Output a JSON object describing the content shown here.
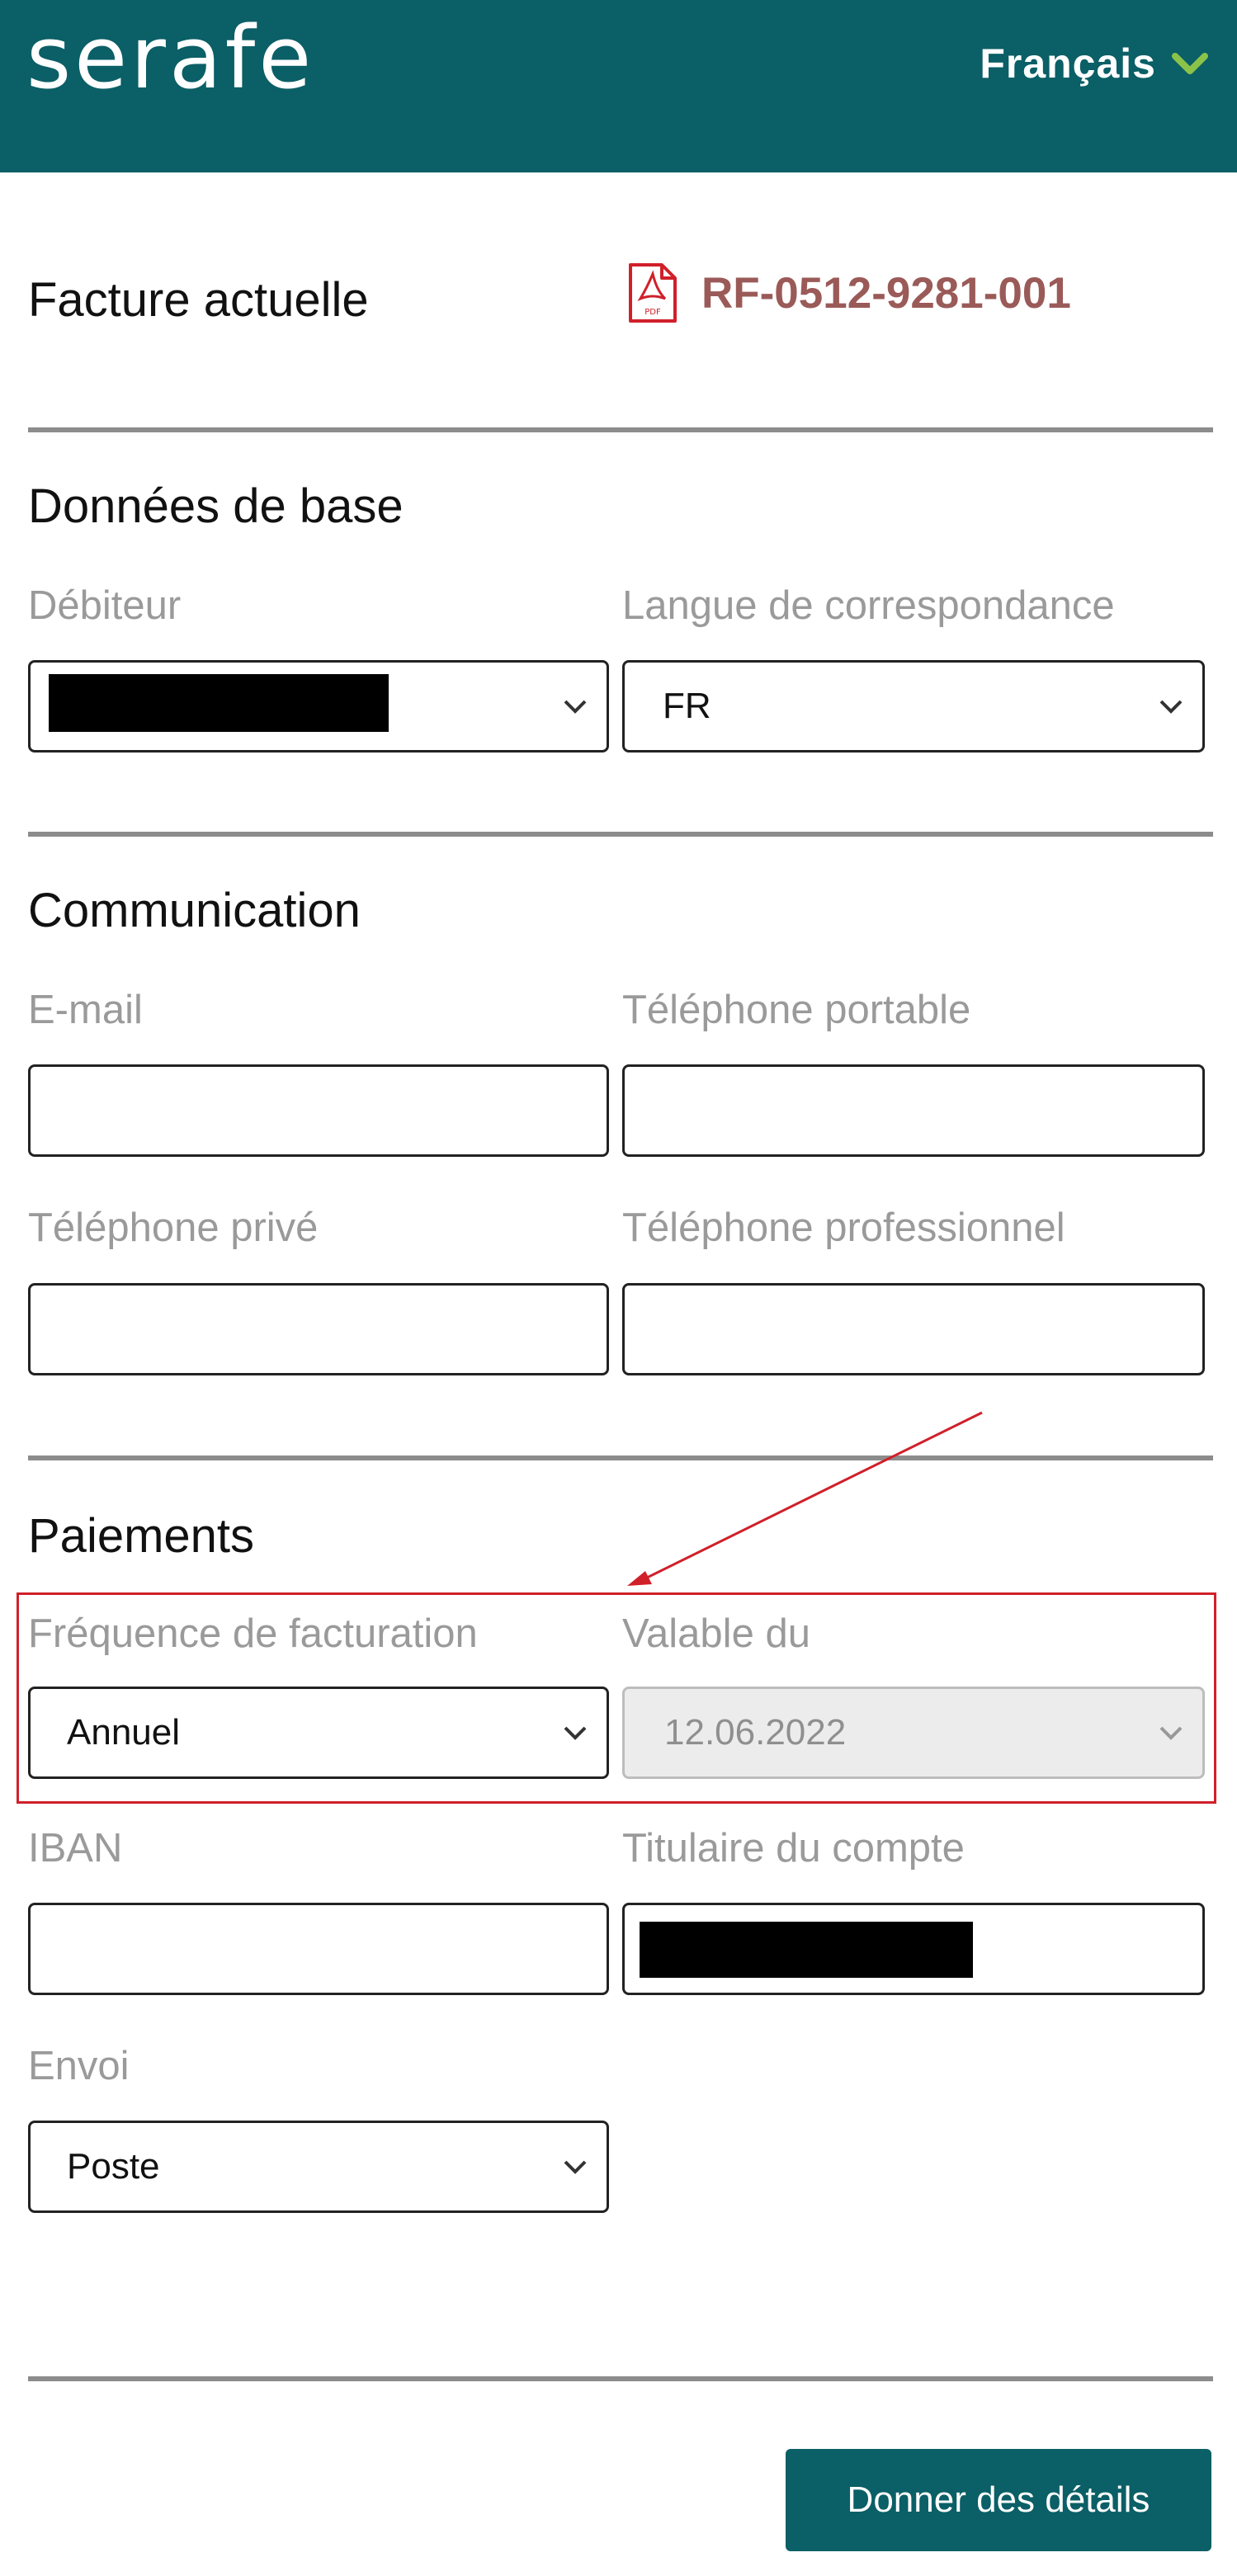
{
  "header": {
    "logo_text": "serafe",
    "language": "Français"
  },
  "invoice": {
    "label": "Facture actuelle",
    "number": "RF-0512-9281-001",
    "icon": "pdf-icon"
  },
  "basic_data": {
    "title": "Données de base",
    "debtor_label": "Débiteur",
    "debtor_value": "",
    "correspondence_label": "Langue de correspondance",
    "correspondence_value": "FR"
  },
  "communication": {
    "title": "Communication",
    "email_label": "E-mail",
    "email_value": "",
    "mobile_label": "Téléphone portable",
    "mobile_value": "",
    "private_phone_label": "Téléphone privé",
    "private_phone_value": "",
    "work_phone_label": "Téléphone professionnel",
    "work_phone_value": ""
  },
  "payments": {
    "title": "Paiements",
    "frequency_label": "Fréquence de facturation",
    "frequency_value": "Annuel",
    "valid_from_label": "Valable du",
    "valid_from_value": "12.06.2022",
    "iban_label": "IBAN",
    "iban_value": "",
    "account_holder_label": "Titulaire du compte",
    "account_holder_value": "",
    "delivery_label": "Envoi",
    "delivery_value": "Poste"
  },
  "actions": {
    "submit_label": "Donner des détails"
  },
  "colors": {
    "brand": "#0b5f66",
    "invoice_link": "#9a5a58",
    "annotation": "#d0202a"
  }
}
